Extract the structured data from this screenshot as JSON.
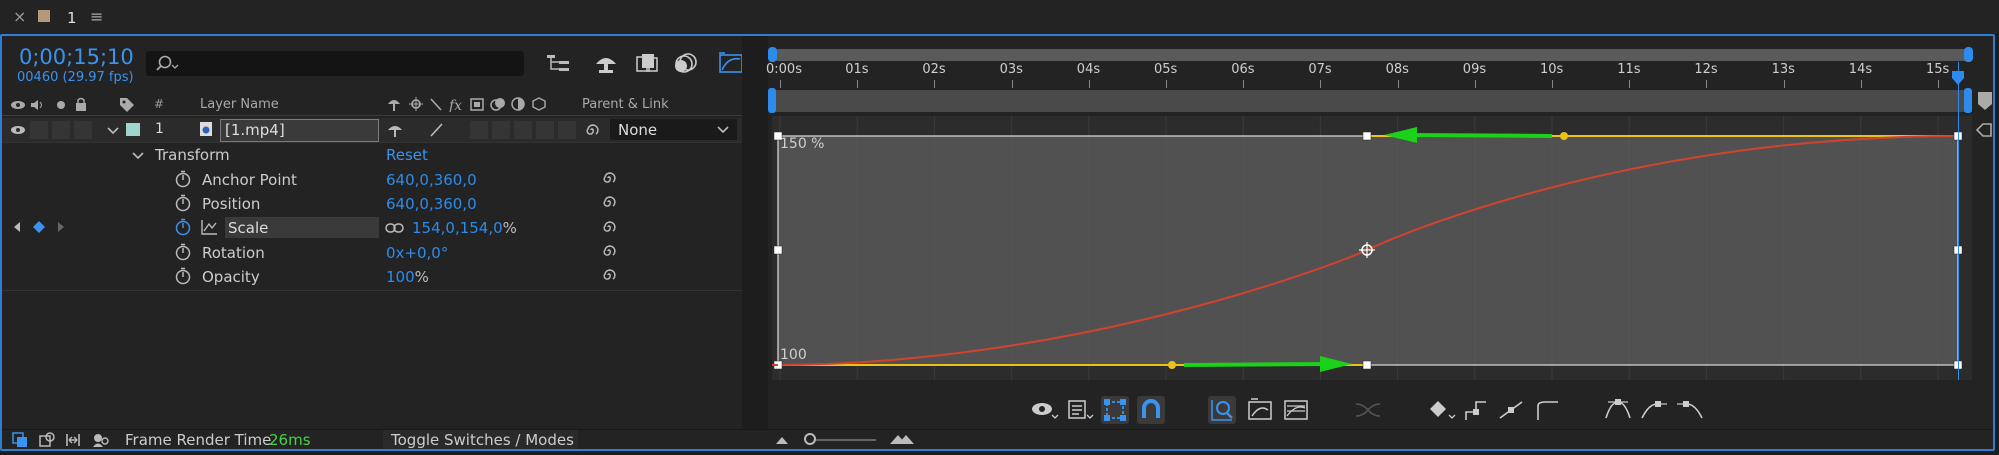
{
  "tab": {
    "close": "×",
    "title": "1",
    "menu": "≡",
    "color": "#b49a7a"
  },
  "time": {
    "timecode": "0;00;15;10",
    "frames": "00460 (29.97 fps)"
  },
  "search": {
    "placeholder": ""
  },
  "columns": {
    "hash": "#",
    "layer_name": "Layer Name",
    "parent_link": "Parent & Link"
  },
  "layer": {
    "index": "1",
    "name": "[1.mp4]",
    "parent": "None",
    "label_color": "#9fd4cf"
  },
  "transform": {
    "label": "Transform",
    "reset": "Reset",
    "properties": [
      {
        "name": "Anchor Point",
        "value": "640,0,360,0",
        "unit": ""
      },
      {
        "name": "Position",
        "value": "640,0,360,0",
        "unit": ""
      },
      {
        "name": "Scale",
        "value": "154,0,154,0",
        "unit": "%"
      },
      {
        "name": "Rotation",
        "value": "0x+0,0°",
        "unit": ""
      },
      {
        "name": "Opacity",
        "value": "100",
        "unit": "%"
      }
    ]
  },
  "ruler": {
    "ticks": [
      "0:00s",
      "01s",
      "02s",
      "03s",
      "04s",
      "05s",
      "06s",
      "07s",
      "08s",
      "09s",
      "10s",
      "11s",
      "12s",
      "13s",
      "14s",
      "15s"
    ]
  },
  "graph": {
    "top_label": "150 %",
    "bottom_label": "100"
  },
  "status": {
    "render_label": "Frame Render Time",
    "render_value": "26ms",
    "toggle": "Toggle Switches / Modes"
  },
  "colors": {
    "accent": "#2d8ceb",
    "curve": "#d0432f",
    "handle": "#e9c21a",
    "arrow": "#19d219",
    "green_text": "#4ad04a"
  }
}
